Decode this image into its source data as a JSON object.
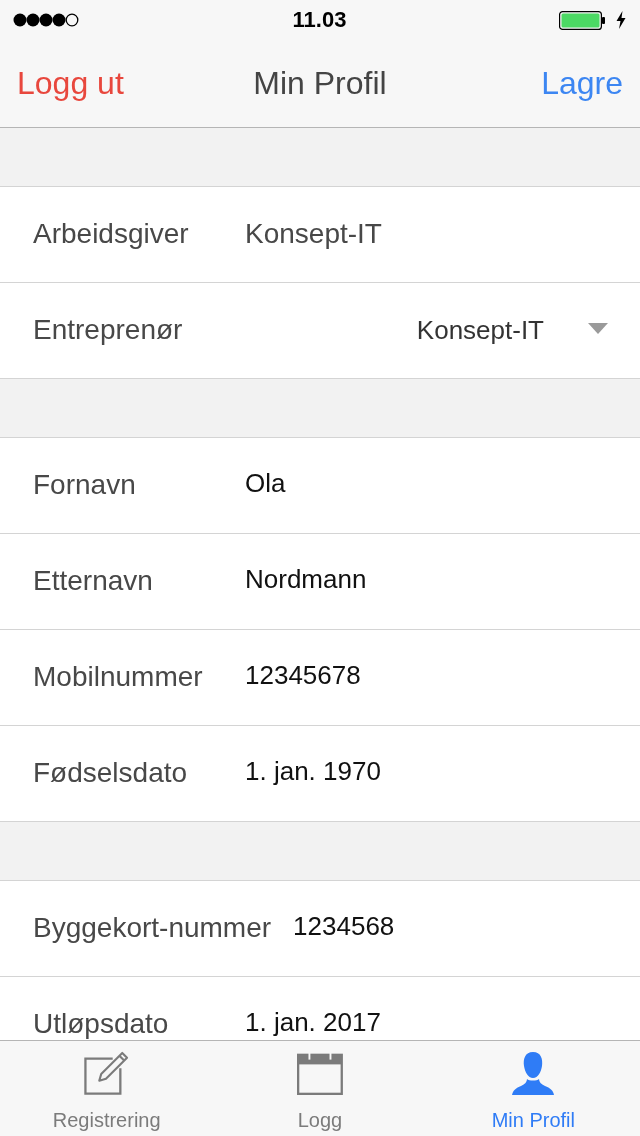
{
  "status_bar": {
    "time": "11.03"
  },
  "nav_bar": {
    "left_button": "Logg ut",
    "title": "Min Profil",
    "right_button": "Lagre"
  },
  "sections": [
    {
      "rows": [
        {
          "kind": "text",
          "label": "Arbeidsgiver",
          "value": "Konsept-IT"
        },
        {
          "kind": "dropdown",
          "label": "Entreprenør",
          "value": "Konsept-IT"
        }
      ]
    },
    {
      "rows": [
        {
          "kind": "input",
          "label": "Fornavn",
          "value": "Ola"
        },
        {
          "kind": "input",
          "label": "Etternavn",
          "value": "Nordmann"
        },
        {
          "kind": "input",
          "label": "Mobilnummer",
          "value": "12345678"
        },
        {
          "kind": "input",
          "label": "Fødselsdato",
          "value": "1. jan. 1970"
        }
      ]
    },
    {
      "rows": [
        {
          "kind": "input",
          "label": "Byggekort-nummer",
          "value": "1234568"
        },
        {
          "kind": "input",
          "label": "Utløpsdato",
          "value": "1. jan. 2017"
        }
      ]
    }
  ],
  "tab_bar": {
    "tabs": [
      {
        "label": "Registrering",
        "selected": false
      },
      {
        "label": "Logg",
        "selected": false
      },
      {
        "label": "Min Profil",
        "selected": true
      }
    ]
  }
}
